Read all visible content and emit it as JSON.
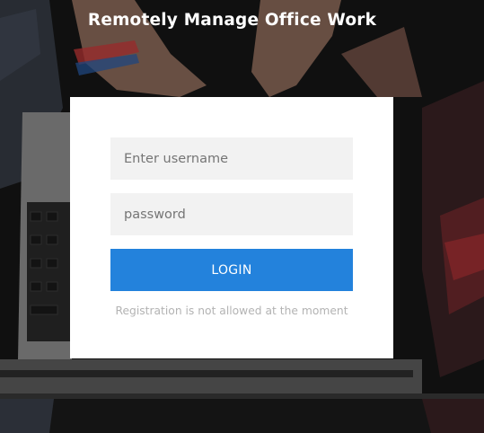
{
  "header": {
    "title": "Remotely Manage Office Work"
  },
  "login_form": {
    "username_placeholder": "Enter username",
    "username_value": "",
    "password_placeholder": "password",
    "password_value": "",
    "login_label": "LOGIN",
    "registration_message": "Registration is not allowed at the moment"
  },
  "colors": {
    "button_bg": "#2382dc",
    "card_bg": "#ffffff",
    "field_bg": "#f2f2f2",
    "note_text": "#b3b3b3"
  }
}
